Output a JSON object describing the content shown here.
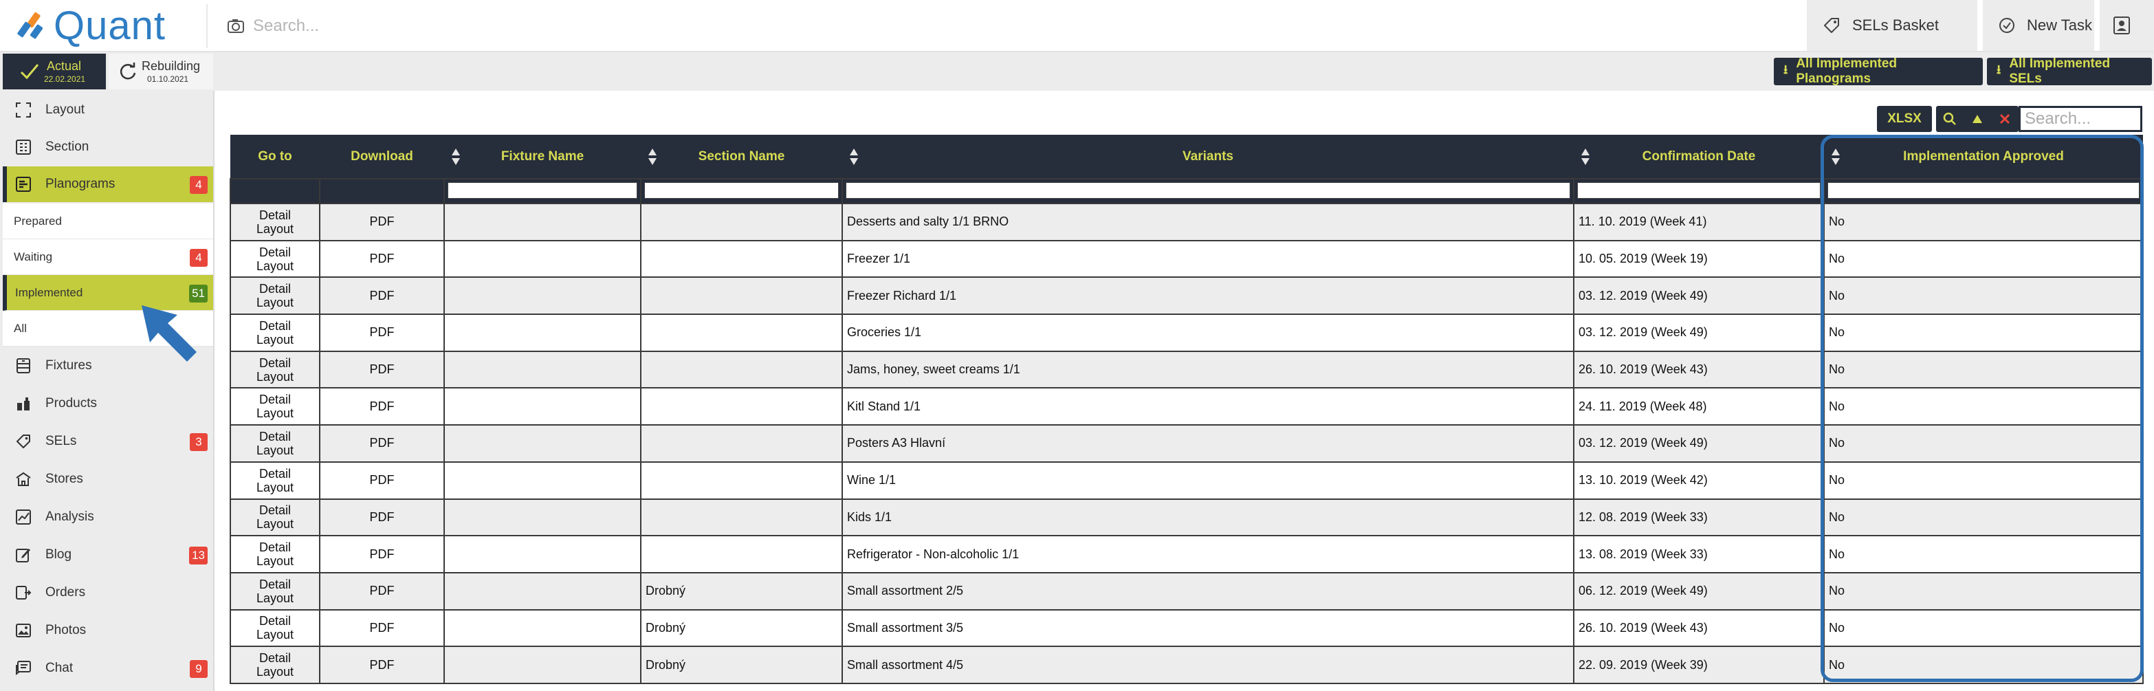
{
  "app": {
    "name": "Quant"
  },
  "topbar": {
    "search_placeholder": "Search...",
    "sels_basket_label": "SELs Basket",
    "new_task_label": "New Task"
  },
  "modes": {
    "actual_label": "Actual",
    "actual_date": "22.02.2021",
    "rebuilding_label": "Rebuilding",
    "rebuilding_date": "01.10.2021"
  },
  "actions": {
    "all_implemented_planograms": "All Implemented Planograms",
    "all_implemented_sels": "All Implemented SELs",
    "xlsx": "XLSX",
    "table_search_placeholder": "Search..."
  },
  "sidebar": {
    "layout": "Layout",
    "section": "Section",
    "planograms": "Planograms",
    "planograms_count": "4",
    "sub": {
      "prepared": "Prepared",
      "waiting": "Waiting",
      "waiting_count": "4",
      "implemented": "Implemented",
      "implemented_count": "51",
      "all": "All"
    },
    "fixtures": "Fixtures",
    "products": "Products",
    "sels": "SELs",
    "sels_count": "3",
    "stores": "Stores",
    "analysis": "Analysis",
    "blog": "Blog",
    "blog_count": "13",
    "orders": "Orders",
    "photos": "Photos",
    "chat": "Chat",
    "chat_count": "9"
  },
  "table": {
    "columns": [
      "Go to",
      "Download",
      "Fixture Name",
      "Section Name",
      "Variants",
      "Confirmation Date",
      "Implementation Approved"
    ],
    "rows": [
      {
        "goto": "Detail Layout",
        "download": "PDF",
        "fixture": "",
        "section": "",
        "variant": "Desserts and salty 1/1 BRNO",
        "date": "11. 10. 2019 (Week 41)",
        "approved": "No"
      },
      {
        "goto": "Detail Layout",
        "download": "PDF",
        "fixture": "",
        "section": "",
        "variant": "Freezer 1/1",
        "date": "10. 05. 2019 (Week 19)",
        "approved": "No"
      },
      {
        "goto": "Detail Layout",
        "download": "PDF",
        "fixture": "",
        "section": "",
        "variant": "Freezer Richard 1/1",
        "date": "03. 12. 2019 (Week 49)",
        "approved": "No"
      },
      {
        "goto": "Detail Layout",
        "download": "PDF",
        "fixture": "",
        "section": "",
        "variant": "Groceries 1/1",
        "date": "03. 12. 2019 (Week 49)",
        "approved": "No"
      },
      {
        "goto": "Detail Layout",
        "download": "PDF",
        "fixture": "",
        "section": "",
        "variant": "Jams, honey, sweet creams 1/1",
        "date": "26. 10. 2019 (Week 43)",
        "approved": "No"
      },
      {
        "goto": "Detail Layout",
        "download": "PDF",
        "fixture": "",
        "section": "",
        "variant": "Kitl Stand 1/1",
        "date": "24. 11. 2019 (Week 48)",
        "approved": "No"
      },
      {
        "goto": "Detail Layout",
        "download": "PDF",
        "fixture": "",
        "section": "",
        "variant": "Posters A3 Hlavní",
        "date": "03. 12. 2019 (Week 49)",
        "approved": "No"
      },
      {
        "goto": "Detail Layout",
        "download": "PDF",
        "fixture": "",
        "section": "",
        "variant": "Wine 1/1",
        "date": "13. 10. 2019 (Week 42)",
        "approved": "No"
      },
      {
        "goto": "Detail Layout",
        "download": "PDF",
        "fixture": "",
        "section": "",
        "variant": "Kids 1/1",
        "date": "12. 08. 2019 (Week 33)",
        "approved": "No"
      },
      {
        "goto": "Detail Layout",
        "download": "PDF",
        "fixture": "",
        "section": "",
        "variant": "Refrigerator - Non-alcoholic 1/1",
        "date": "13. 08. 2019 (Week 33)",
        "approved": "No"
      },
      {
        "goto": "Detail Layout",
        "download": "PDF",
        "fixture": "",
        "section": "Drobný",
        "variant": "Small assortment 2/5",
        "date": "06. 12. 2019 (Week 49)",
        "approved": "No"
      },
      {
        "goto": "Detail Layout",
        "download": "PDF",
        "fixture": "",
        "section": "Drobný",
        "variant": "Small assortment 3/5",
        "date": "26. 10. 2019 (Week 43)",
        "approved": "No"
      },
      {
        "goto": "Detail Layout",
        "download": "PDF",
        "fixture": "",
        "section": "Drobný",
        "variant": "Small assortment 4/5",
        "date": "22. 09. 2019 (Week 39)",
        "approved": "No"
      }
    ]
  },
  "colors": {
    "dark": "#262d3b",
    "accent": "#c3cc3d",
    "accent_text": "#d6dc52",
    "badge_red": "#e8463a",
    "badge_green": "#4f8a1f",
    "logo_blue": "#2f7ec4",
    "highlight": "#2f6fb0"
  }
}
